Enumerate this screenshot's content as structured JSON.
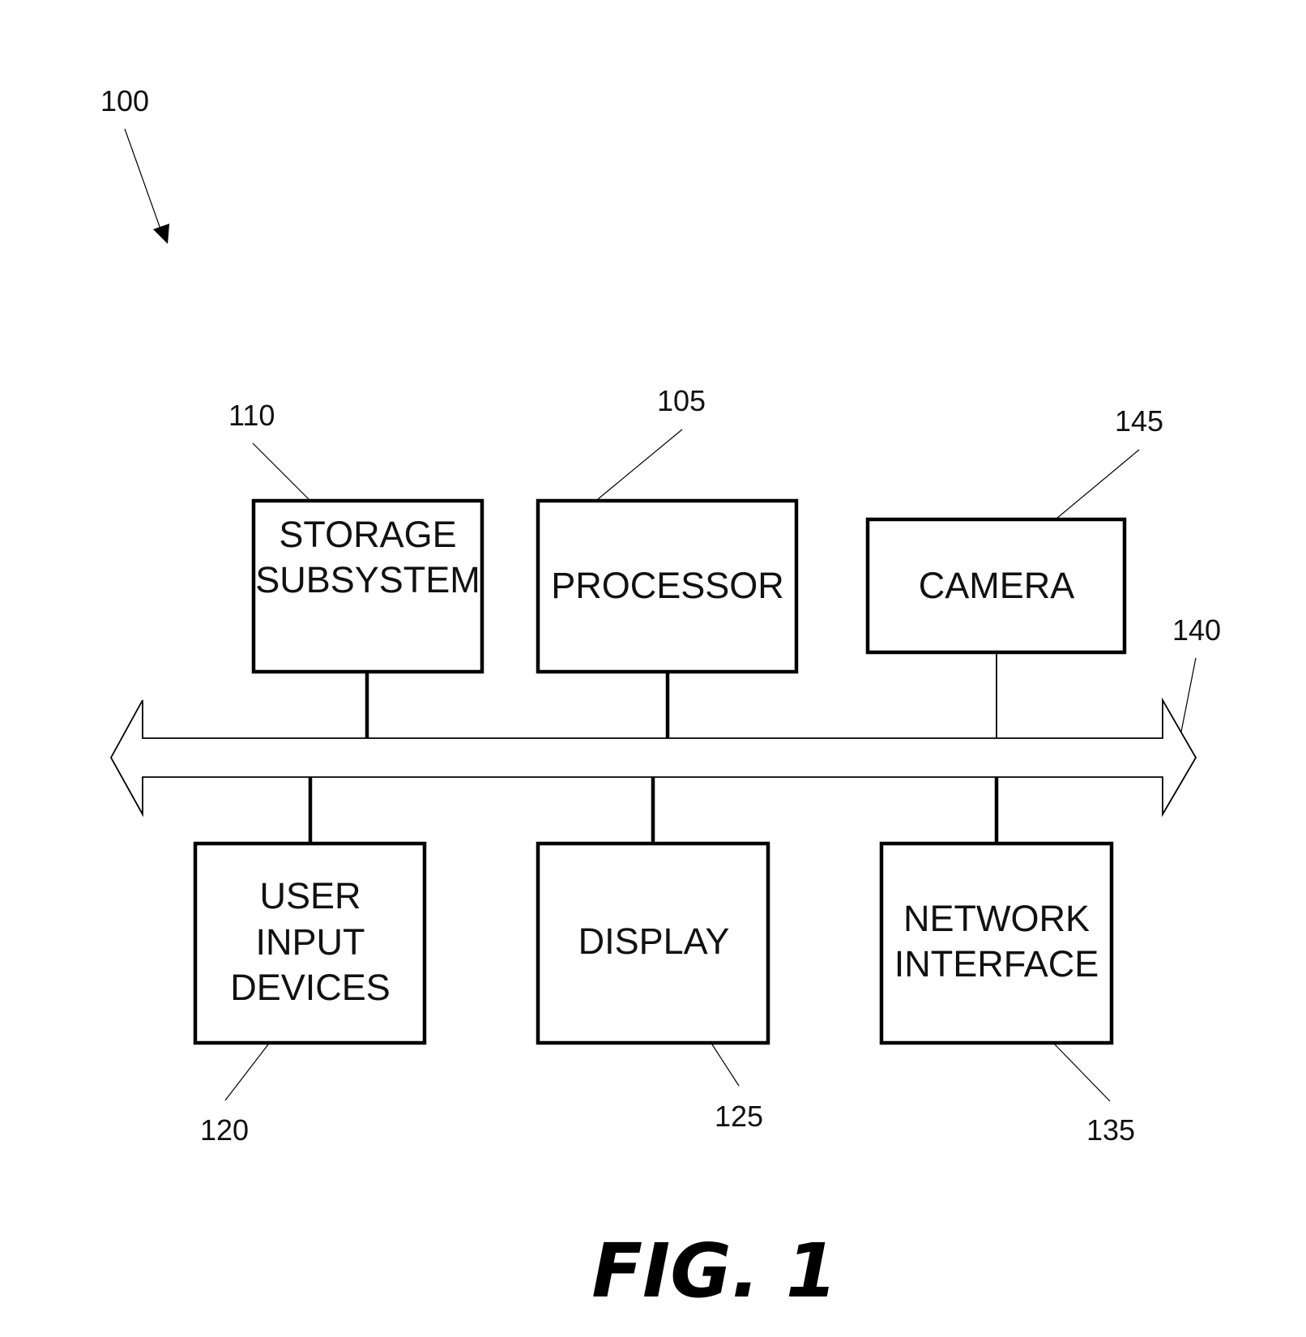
{
  "figure": {
    "caption": "FIG. 1",
    "system_ref": "100",
    "bus": {
      "ref": "140"
    },
    "components": [
      {
        "id": "storage",
        "ref": "110",
        "lines": [
          "STORAGE",
          "SUBSYSTEM"
        ],
        "position": "top-left"
      },
      {
        "id": "processor",
        "ref": "105",
        "lines": [
          "PROCESSOR"
        ],
        "position": "top-center"
      },
      {
        "id": "camera",
        "ref": "145",
        "lines": [
          "CAMERA"
        ],
        "position": "top-right"
      },
      {
        "id": "user-input",
        "ref": "120",
        "lines": [
          "USER",
          "INPUT",
          "DEVICES"
        ],
        "position": "bottom-left"
      },
      {
        "id": "display",
        "ref": "125",
        "lines": [
          "DISPLAY"
        ],
        "position": "bottom-center"
      },
      {
        "id": "network",
        "ref": "135",
        "lines": [
          "NETWORK",
          "INTERFACE"
        ],
        "position": "bottom-right"
      }
    ]
  }
}
